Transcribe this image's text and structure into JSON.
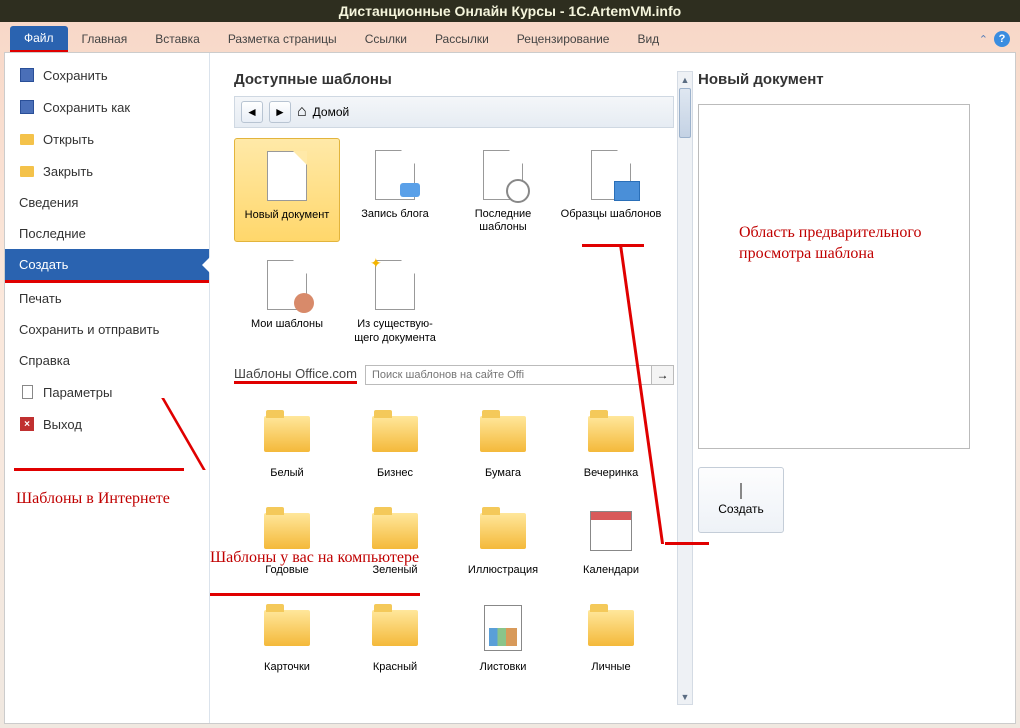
{
  "title": "Дистанционные Онлайн Курсы - 1C.ArtemVM.info",
  "ribbon": {
    "tabs": [
      "Файл",
      "Главная",
      "Вставка",
      "Разметка страницы",
      "Ссылки",
      "Рассылки",
      "Рецензирование",
      "Вид"
    ],
    "active": 0
  },
  "sidebar": {
    "items": [
      {
        "label": "Сохранить",
        "icon": "disk"
      },
      {
        "label": "Сохранить как",
        "icon": "disk"
      },
      {
        "label": "Открыть",
        "icon": "folder"
      },
      {
        "label": "Закрыть",
        "icon": "folder"
      },
      {
        "label": "Сведения"
      },
      {
        "label": "Последние"
      },
      {
        "label": "Создать",
        "selected": true
      },
      {
        "label": "Печать"
      },
      {
        "label": "Сохранить и отправить"
      },
      {
        "label": "Справка"
      },
      {
        "label": "Параметры",
        "icon": "doc"
      },
      {
        "label": "Выход",
        "icon": "x"
      }
    ]
  },
  "templates": {
    "section_title": "Доступные шаблоны",
    "home_label": "Домой",
    "local": [
      {
        "label": "Новый документ",
        "selected": true,
        "icon": "blank"
      },
      {
        "label": "Запись блога",
        "icon": "blog"
      },
      {
        "label": "Последние шаблоны",
        "icon": "recent"
      },
      {
        "label": "Образцы шаблонов",
        "icon": "samples"
      },
      {
        "label": "Мои шаблоны",
        "icon": "mytmpl"
      },
      {
        "label": "Из существую-\nщего документа",
        "icon": "existing"
      }
    ],
    "office_section": "Шаблоны Office.com",
    "search_placeholder": "Поиск шаблонов на сайте Offi",
    "online": [
      {
        "label": "Белый"
      },
      {
        "label": "Бизнес"
      },
      {
        "label": "Бумага"
      },
      {
        "label": "Вечеринка"
      },
      {
        "label": "Годовые"
      },
      {
        "label": "Зеленый"
      },
      {
        "label": "Иллюстрация"
      },
      {
        "label": "Календари",
        "icon": "calendar"
      },
      {
        "label": "Карточки"
      },
      {
        "label": "Красный"
      },
      {
        "label": "Листовки",
        "icon": "flyer"
      },
      {
        "label": "Личные"
      }
    ]
  },
  "preview": {
    "title": "Новый документ",
    "create_label": "Создать"
  },
  "annotations": {
    "internet": "Шаблоны в Интернете",
    "computer": "Шаблоны у вас на компьютере",
    "preview_area": "Область предварительного просмотра шаблона"
  }
}
